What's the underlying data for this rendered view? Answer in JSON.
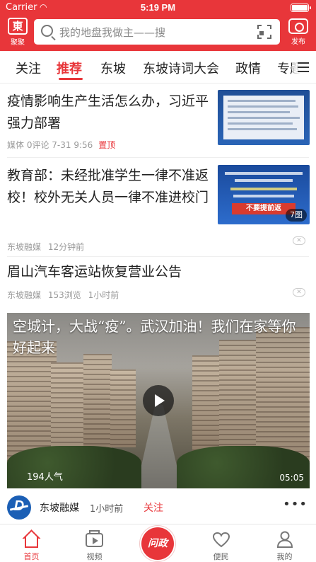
{
  "status_bar": {
    "carrier": "Carrier",
    "time": "5:19 PM"
  },
  "header": {
    "logo_mark": "東",
    "logo_label": "聚聚",
    "search_placeholder": "我的地盘我做主——搜",
    "publish_label": "发布"
  },
  "tabs": [
    {
      "label": "关注",
      "active": false
    },
    {
      "label": "推荐",
      "active": true
    },
    {
      "label": "东坡",
      "active": false
    },
    {
      "label": "东坡诗词大会",
      "active": false
    },
    {
      "label": "政情",
      "active": false
    },
    {
      "label": "专题",
      "active": false
    }
  ],
  "feed": [
    {
      "title": "疫情影响生产生活怎么办，习近平强力部署",
      "meta": "媒体 0评论 7-31 9:56",
      "pinned_label": "置顶"
    },
    {
      "title": "教育部：未经批准学生一律不准返校！校外无关人员一律不准进校门",
      "source": "东坡融媒",
      "time": "12分钟前",
      "image_count": "7图",
      "thumb_warning": "不要提前返"
    },
    {
      "title": "眉山汽车客运站恢复营业公告",
      "source": "东坡融媒",
      "views": "153浏览",
      "time": "1小时前"
    },
    {
      "title": "空城计，大战“疫”。武汉加油！我们在家等你好起来",
      "popularity": "194人气",
      "duration": "05:05",
      "author": "东坡融媒",
      "time": "1小时前",
      "follow_label": "关注"
    }
  ],
  "bottom_nav": [
    {
      "label": "首页",
      "icon": "home-icon",
      "active": true
    },
    {
      "label": "视频",
      "icon": "video-icon",
      "active": false
    },
    {
      "label": "问政",
      "icon": "wenzheng-badge",
      "active": false
    },
    {
      "label": "便民",
      "icon": "heart-icon",
      "active": false
    },
    {
      "label": "我的",
      "icon": "user-icon",
      "active": false
    }
  ],
  "colors": {
    "brand_red": "#e8363a",
    "text": "#222222",
    "meta_gray": "#999999"
  }
}
